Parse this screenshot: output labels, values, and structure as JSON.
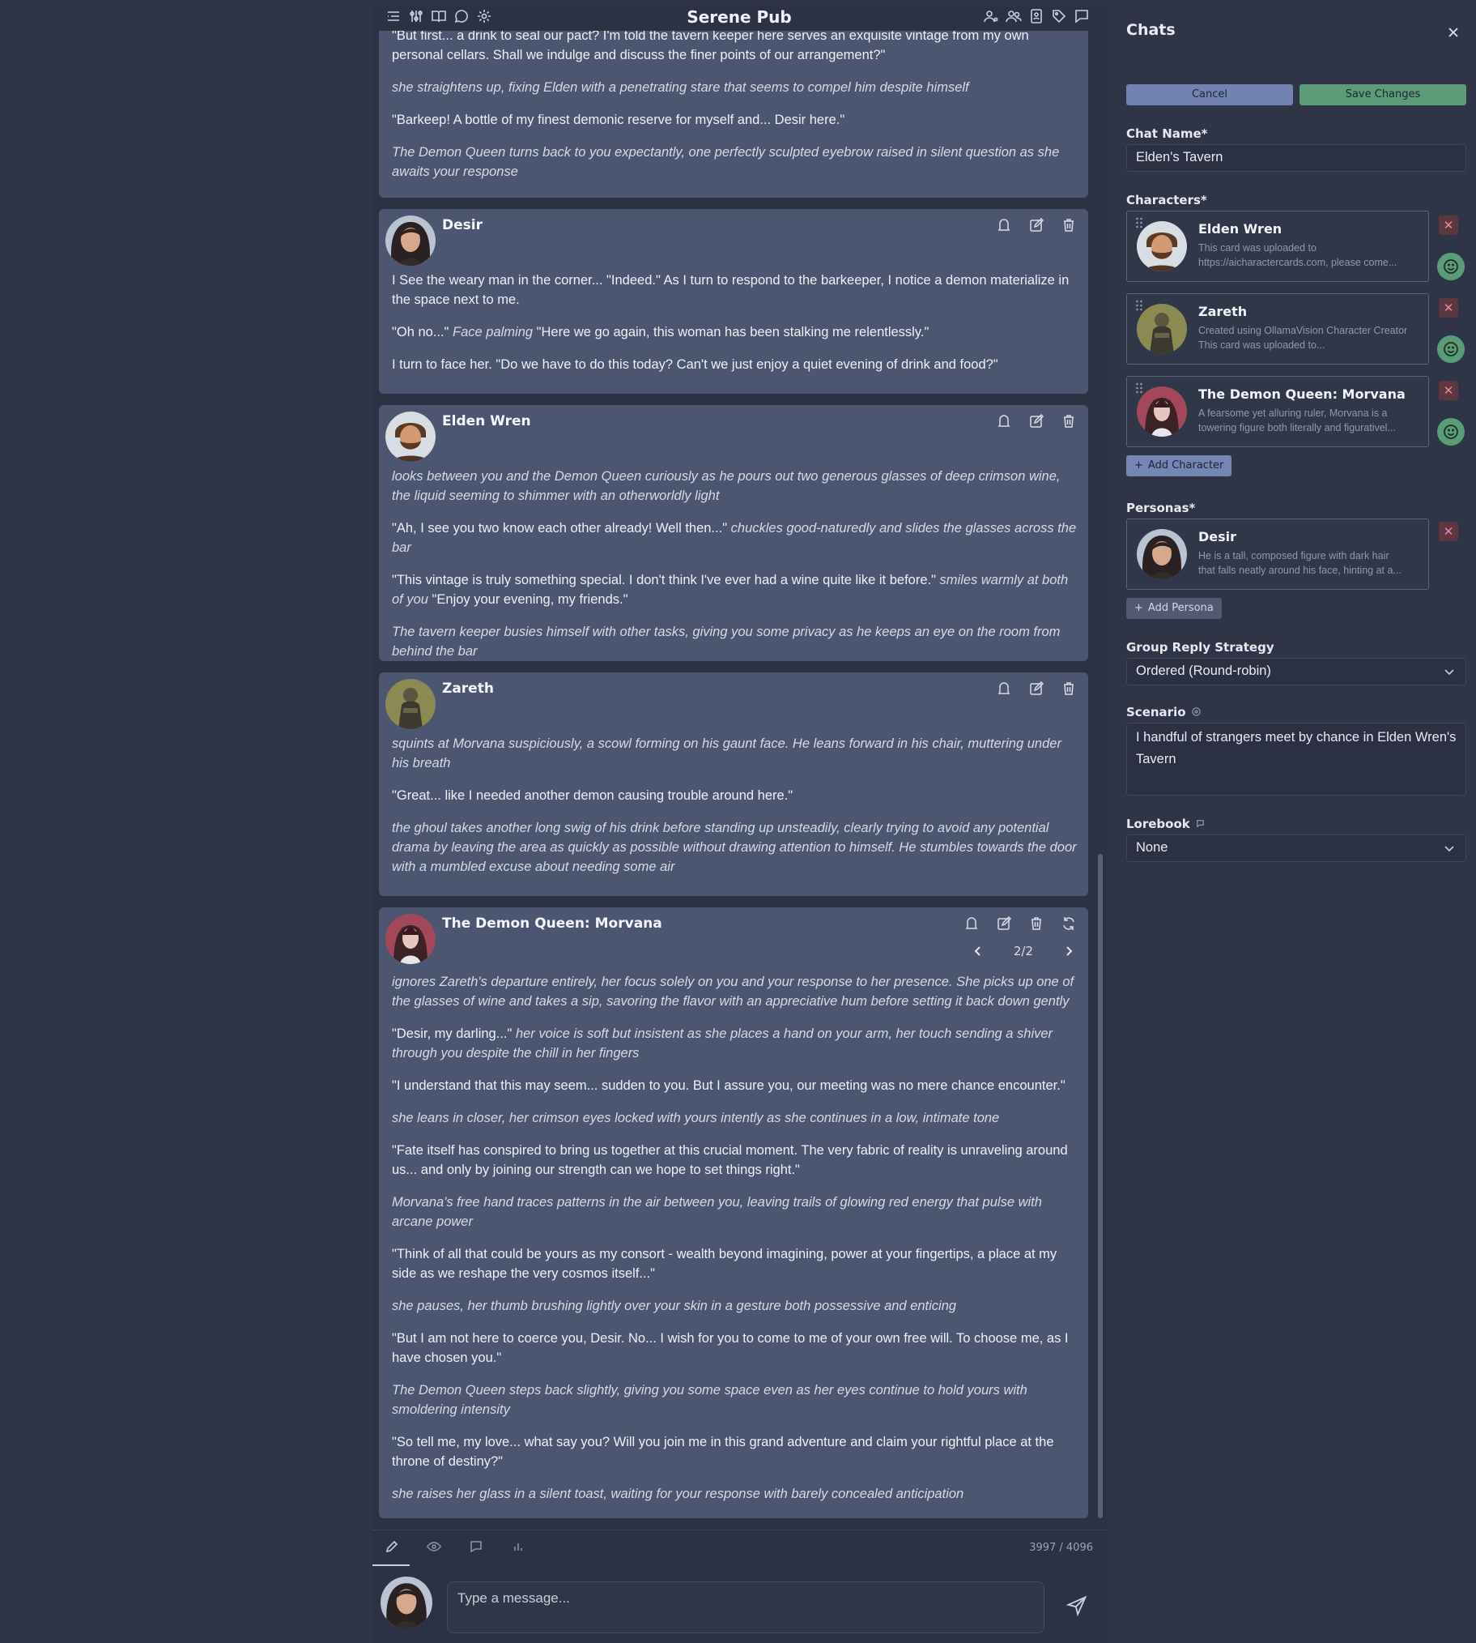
{
  "app": {
    "title": "Serene Pub"
  },
  "messages": [
    {
      "id": "m0",
      "author": "",
      "paragraphs": [
        [
          {
            "t": "\"But first... a drink to seal our pact? I'm told the tavern keeper here serves an exquisite vintage from my own personal cellars. Shall we indulge and discuss the finer points of our arrangement?\"",
            "i": false
          }
        ],
        [
          {
            "t": "she straightens up, fixing Elden with a penetrating stare that seems to compel him despite himself",
            "i": true
          }
        ],
        [
          {
            "t": "\"Barkeep! A bottle of my finest demonic reserve for myself and... Desir here.\"",
            "i": false
          }
        ],
        [
          {
            "t": "The Demon Queen turns back to you expectantly, one perfectly sculpted eyebrow raised in silent question as she awaits your response",
            "i": true
          }
        ]
      ]
    },
    {
      "id": "m1",
      "author": "Desir",
      "paragraphs": [
        [
          {
            "t": "I See the weary man in the corner... \"Indeed.\" As I turn to respond to the barkeeper, I notice a demon materialize in the space next to me.",
            "i": false
          }
        ],
        [
          {
            "t": "\"Oh no...\" ",
            "i": false
          },
          {
            "t": "Face palming",
            "i": true
          },
          {
            "t": " \"Here we go again, this woman has been stalking me relentlessly.\"",
            "i": false
          }
        ],
        [
          {
            "t": "I turn to face her. \"Do we have to do this today? Can't we just enjoy a quiet evening of drink and food?\"",
            "i": false
          }
        ]
      ]
    },
    {
      "id": "m2",
      "author": "Elden Wren",
      "paragraphs": [
        [
          {
            "t": "looks between you and the Demon Queen curiously as he pours out two generous glasses of deep crimson wine, the liquid seeming to shimmer with an otherworldly light",
            "i": true
          }
        ],
        [
          {
            "t": "\"Ah, I see you two know each other already! Well then...\" ",
            "i": false
          },
          {
            "t": "chuckles good-naturedly and slides the glasses across the bar",
            "i": true
          }
        ],
        [
          {
            "t": "\"This vintage is truly something special. I don't think I've ever had a wine quite like it before.\" ",
            "i": false
          },
          {
            "t": "smiles warmly at both of you",
            "i": true
          },
          {
            "t": " \"Enjoy your evening, my friends.\"",
            "i": false
          }
        ],
        [
          {
            "t": "The tavern keeper busies himself with other tasks, giving you some privacy as he keeps an eye on the room from behind the bar",
            "i": true
          }
        ]
      ]
    },
    {
      "id": "m3",
      "author": "Zareth",
      "paragraphs": [
        [
          {
            "t": "squints at Morvana suspiciously, a scowl forming on his gaunt face. He leans forward in his chair, muttering under his breath",
            "i": true
          }
        ],
        [
          {
            "t": "\"Great... like I needed another demon causing trouble around here.\"",
            "i": false
          }
        ],
        [
          {
            "t": "the ghoul takes another long swig of his drink before standing up unsteadily, clearly trying to avoid any potential drama by leaving the area as quickly as possible without drawing attention to himself. He stumbles towards the door with a mumbled excuse about needing some air",
            "i": true
          }
        ]
      ]
    },
    {
      "id": "m4",
      "author": "The Demon Queen: Morvana",
      "swipe": "2/2",
      "paragraphs": [
        [
          {
            "t": "ignores Zareth's departure entirely, her focus solely on you and your response to her presence. She picks up one of the glasses of wine and takes a sip, savoring the flavor with an appreciative hum before setting it back down gently",
            "i": true
          }
        ],
        [
          {
            "t": "\"Desir, my darling...\" ",
            "i": false
          },
          {
            "t": "her voice is soft but insistent as she places a hand on your arm, her touch sending a shiver through you despite the chill in her fingers",
            "i": true
          }
        ],
        [
          {
            "t": "\"I understand that this may seem... sudden to you. But I assure you, our meeting was no mere chance encounter.\"",
            "i": false
          }
        ],
        [
          {
            "t": "she leans in closer, her crimson eyes locked with yours intently as she continues in a low, intimate tone",
            "i": true
          }
        ],
        [
          {
            "t": "\"Fate itself has conspired to bring us together at this crucial moment. The very fabric of reality is unraveling around us... and only by joining our strength can we hope to set things right.\"",
            "i": false
          }
        ],
        [
          {
            "t": "Morvana's free hand traces patterns in the air between you, leaving trails of glowing red energy that pulse with arcane power",
            "i": true
          }
        ],
        [
          {
            "t": "\"Think of all that could be yours as my consort - wealth beyond imagining, power at your fingertips, a place at my side as we reshape the very cosmos itself...\"",
            "i": false
          }
        ],
        [
          {
            "t": "she pauses, her thumb brushing lightly over your skin in a gesture both possessive and enticing",
            "i": true
          }
        ],
        [
          {
            "t": "\"But I am not here to coerce you, Desir. No... I wish for you to come to me of your own free will. To choose me, as I have chosen you.\"",
            "i": false
          }
        ],
        [
          {
            "t": "The Demon Queen steps back slightly, giving you some space even as her eyes continue to hold yours with smoldering intensity",
            "i": true
          }
        ],
        [
          {
            "t": "\"So tell me, my love... what say you? Will you join me in this grand adventure and claim your rightful place at the throne of destiny?\"",
            "i": false
          }
        ],
        [
          {
            "t": "she raises her glass in a silent toast, waiting for your response with barely concealed anticipation",
            "i": true
          }
        ]
      ]
    }
  ],
  "composer": {
    "token_count": "3997 / 4096",
    "placeholder": "Type a message..."
  },
  "panel": {
    "title": "Chats",
    "cancel_label": "Cancel",
    "save_label": "Save Changes",
    "chat_name_label": "Chat Name*",
    "chat_name_value": "Elden's Tavern",
    "characters_label": "Characters*",
    "characters": [
      {
        "name": "Elden Wren",
        "desc1": "This card was uploaded to",
        "desc2": "https://aicharactercards.com, please come..."
      },
      {
        "name": "Zareth",
        "desc1": "Created using OllamaVision Character Creator",
        "desc2": "This card was uploaded to..."
      },
      {
        "name": "The Demon Queen: Morvana",
        "desc1": "A fearsome yet alluring ruler, Morvana is a",
        "desc2": "towering figure both literally and figurativel..."
      }
    ],
    "add_character_label": "Add Character",
    "personas_label": "Personas*",
    "persona": {
      "name": "Desir",
      "desc1": "He is a tall, composed figure with dark hair",
      "desc2": "that falls neatly around his face, hinting at a..."
    },
    "add_persona_label": "Add Persona",
    "group_reply_label": "Group Reply Strategy",
    "group_reply_value": "Ordered (Round-robin)",
    "scenario_label": "Scenario",
    "scenario_value": "I handful of strangers meet by chance in Elden Wren's Tavern",
    "lorebook_label": "Lorebook",
    "lorebook_value": "None"
  },
  "colors": {
    "accent_blue": "#7183b0",
    "accent_green": "#5a9c78",
    "danger": "#5c3742"
  }
}
